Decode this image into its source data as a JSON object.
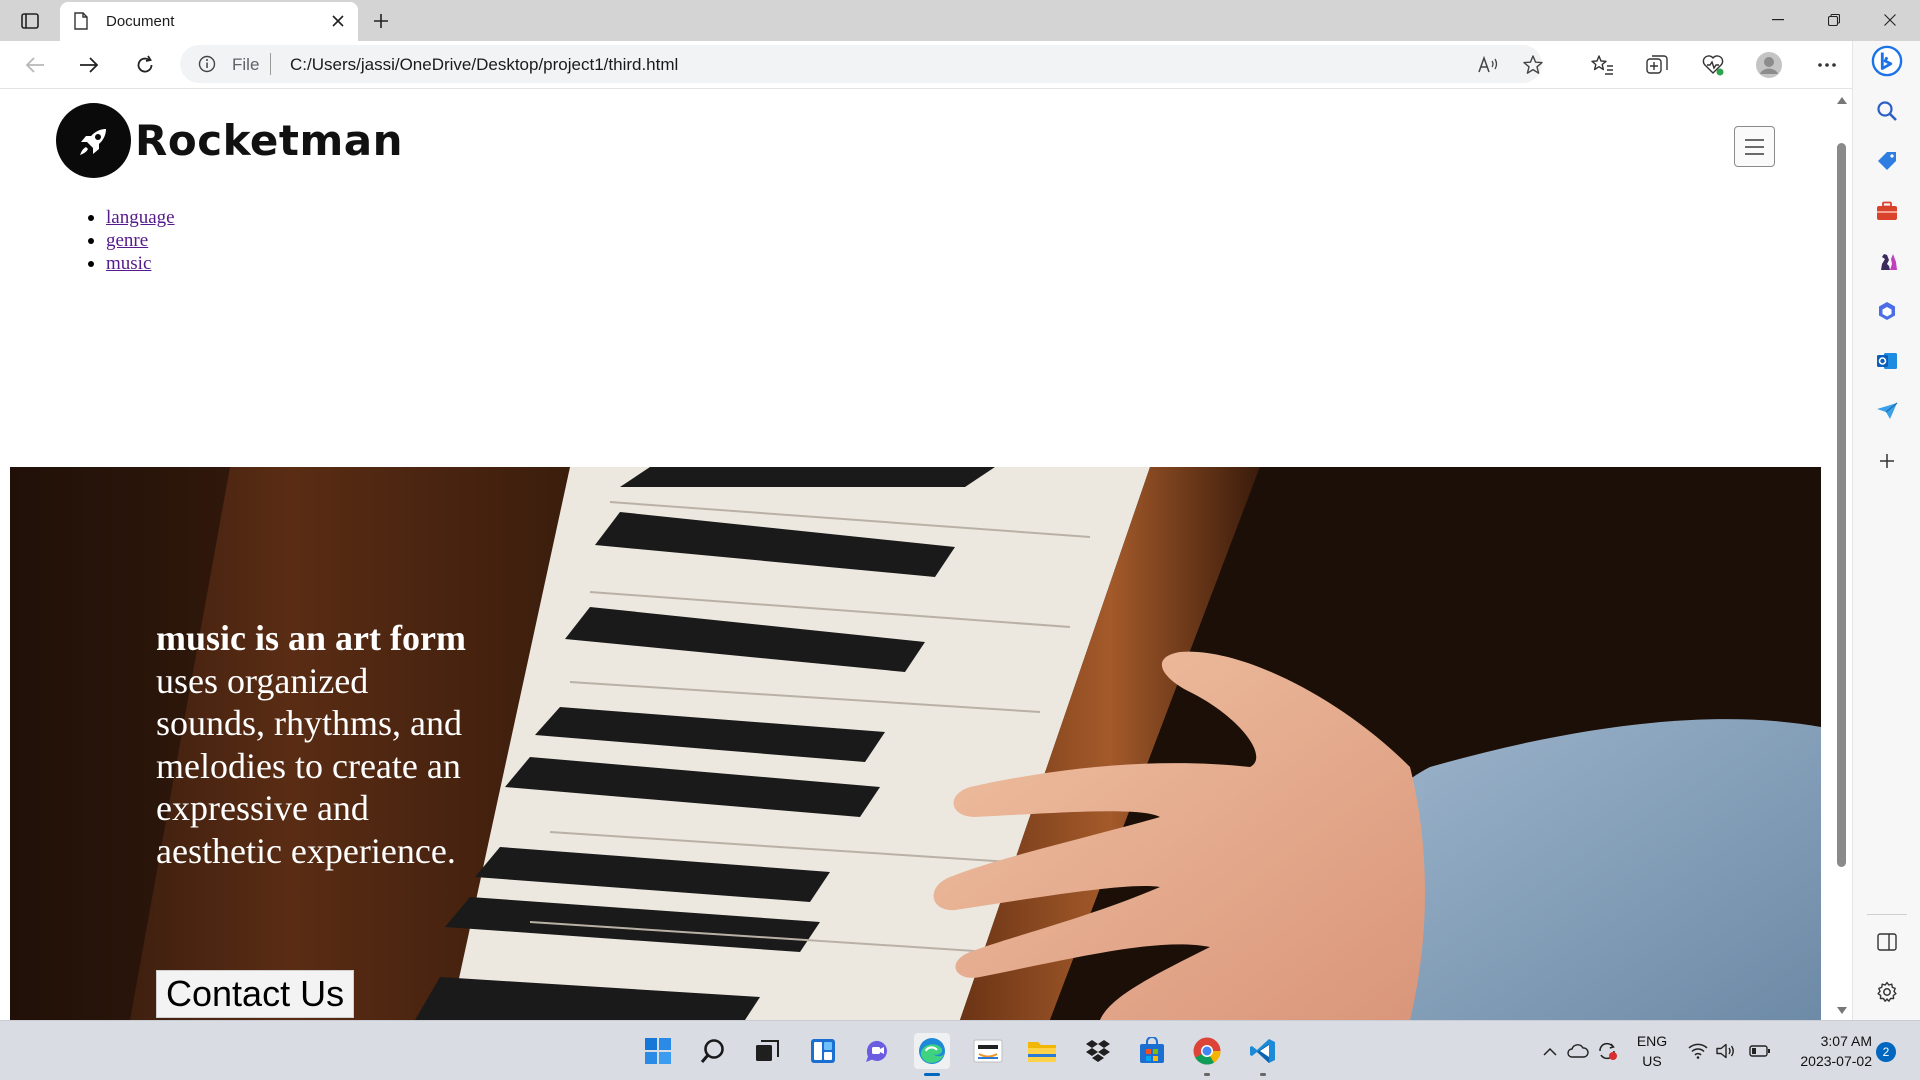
{
  "browser": {
    "tab_title": "Document",
    "address_label": "File",
    "url": "C:/Users/jassi/OneDrive/Desktop/project1/third.html"
  },
  "page": {
    "brand": "Rocketman",
    "nav_links": [
      "language",
      "genre",
      "music"
    ],
    "hero": {
      "headline_bold": "music is an art form",
      "headline_rest": " uses organized sounds, rhythms, and melodies to create an expressive and aesthetic experience.",
      "cta_label": "Contact Us"
    }
  },
  "taskbar": {
    "apps": [
      "start",
      "search",
      "task-view",
      "widgets",
      "teams-chat",
      "edge",
      "amazon",
      "file-explorer",
      "dropbox",
      "microsoft-store",
      "chrome",
      "vscode"
    ],
    "language_line1": "ENG",
    "language_line2": "US",
    "time": "3:07 AM",
    "date": "2023-07-02",
    "notification_count": "2"
  },
  "colors": {
    "link_visited": "#551a8b",
    "edge_accent": "#0067c0"
  }
}
